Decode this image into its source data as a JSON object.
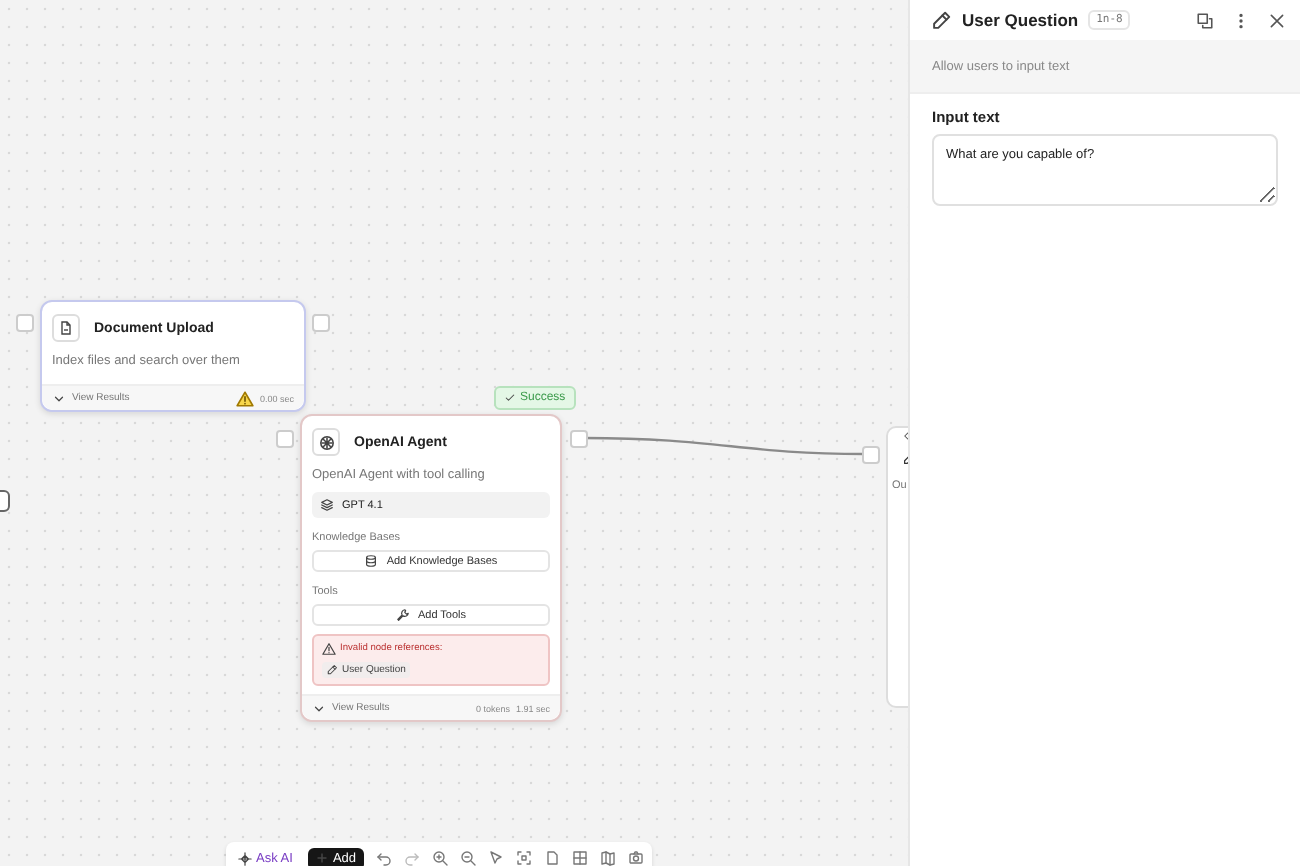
{
  "canvas": {
    "nodes": [
      {
        "kind": "simple",
        "title": "Document Upload",
        "description": "Index files and search over them",
        "footer": "View Results",
        "warning": true,
        "time": "0.00 sec"
      },
      {
        "kind": "agent",
        "status": "Success",
        "title": "OpenAI Agent",
        "description": "OpenAI Agent with tool calling",
        "model": "GPT 4.1",
        "kb_label": "Knowledge Bases",
        "kb_button": "Add Knowledge Bases",
        "tools_label": "Tools",
        "tools_button": "Add Tools",
        "error": "Invalid node references:",
        "error_ref": "User Question",
        "footer": "View Results",
        "tokens": "0 tokens",
        "time": "1.91 sec"
      }
    ],
    "partial_node": {
      "text": "Ou"
    },
    "toolbar": {
      "ask": "Ask AI",
      "add": "Add"
    }
  },
  "panel": {
    "title": "User Question",
    "id": "1n-8",
    "description": "Allow users to input text",
    "field_label": "Input text",
    "field_value": "What are you capable of?"
  }
}
